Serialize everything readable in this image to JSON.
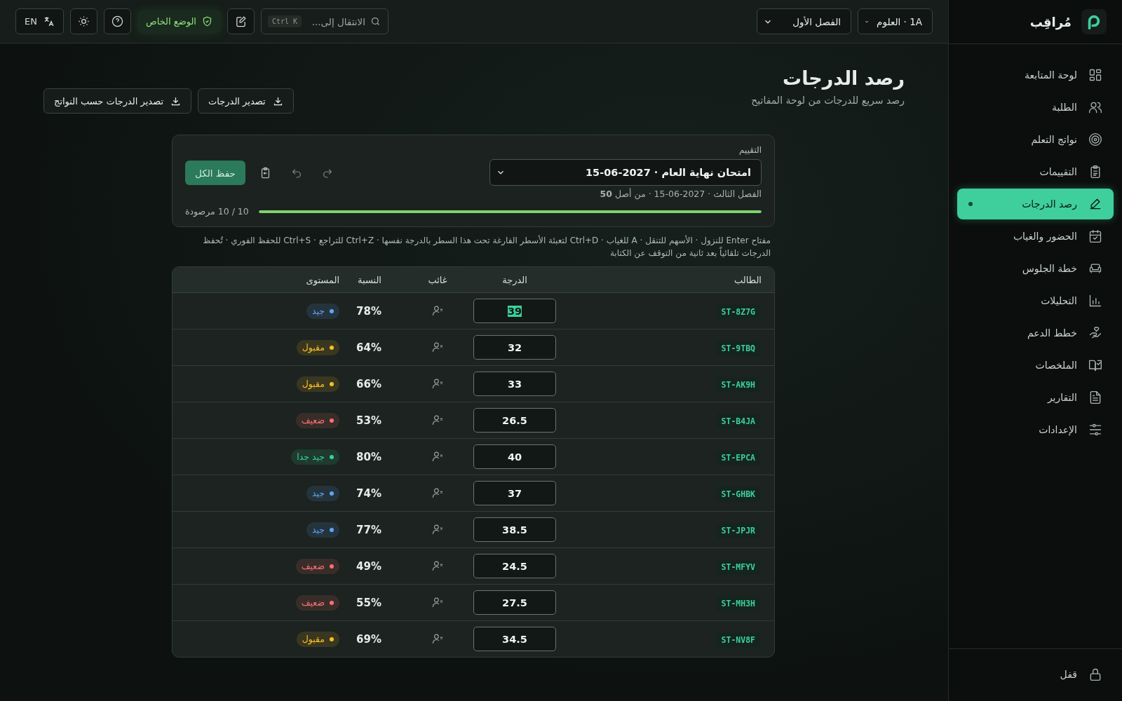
{
  "brand": {
    "name": "مُراقِب"
  },
  "sidebar": {
    "items": [
      {
        "label": "لوحة المتابعة",
        "selected": false
      },
      {
        "label": "الطلبة",
        "selected": false
      },
      {
        "label": "نواتج التعلم",
        "selected": false
      },
      {
        "label": "التقييمات",
        "selected": false
      },
      {
        "label": "رصد الدرجات",
        "selected": true
      },
      {
        "label": "الحضور والغياب",
        "selected": false
      },
      {
        "label": "خطة الجلوس",
        "selected": false
      },
      {
        "label": "التحليلات",
        "selected": false
      },
      {
        "label": "خطط الدعم",
        "selected": false
      },
      {
        "label": "الملخصات",
        "selected": false
      },
      {
        "label": "التقارير",
        "selected": false
      },
      {
        "label": "الإعدادات",
        "selected": false
      }
    ],
    "footer": {
      "label": "قفل"
    }
  },
  "topbar": {
    "class_select": "1A · العلوم",
    "term_select": "الفصل الأول",
    "search": {
      "placeholder": "الانتقال إلى...",
      "shortcut": "Ctrl K"
    },
    "private_mode": "الوضع الخاص",
    "language": "EN"
  },
  "page": {
    "title": "رصد الدرجات",
    "subtitle": "رصد سريع للدرجات من لوحة المفاتيح",
    "buttons": [
      "تصدير الدرجات",
      "تصدير الدرجات حسب النواتج"
    ]
  },
  "assessment": {
    "label": "التقييم",
    "value": "امتحان نهاية العام · 2027-06-15",
    "meta": "الفصل الثالث · 2027-06-15 · من أصل **50**",
    "save_button": "حفظ الكل",
    "progress": {
      "level": 1,
      "reading": "10 / 10 مرصودة"
    }
  },
  "hint": "مفتاح Enter للنزول · الأسهم للتنقل · A للغياب · Ctrl+D لتعبئة الأسطر الفارغة تحت هذا السطر بالدرجة نفسها · Ctrl+Z للتراجع · Ctrl+S للحفظ الفوري · تُحفظ الدرجات تلقائياً بعد ثانية من التوقف عن الكتابة",
  "table": {
    "columns": [
      "الطالب",
      "الدرجة",
      "غائب",
      "النسبة",
      "المستوى"
    ],
    "rows": [
      {
        "student": "ST-8Z7G",
        "grade": "39",
        "selected": true,
        "absent": false,
        "percent": "78%",
        "level_label": "جيد",
        "color": "#60a5fa"
      },
      {
        "student": "ST-9TBQ",
        "grade": "32",
        "selected": false,
        "absent": false,
        "percent": "64%",
        "level_label": "مقبول",
        "color": "#fbbf24"
      },
      {
        "student": "ST-AK9H",
        "grade": "33",
        "selected": false,
        "absent": false,
        "percent": "66%",
        "level_label": "مقبول",
        "color": "#fbbf24"
      },
      {
        "student": "ST-B4JA",
        "grade": "26.5",
        "selected": false,
        "absent": false,
        "percent": "53%",
        "level_label": "ضعيف",
        "color": "#f87171"
      },
      {
        "student": "ST-EPCA",
        "grade": "40",
        "selected": false,
        "absent": false,
        "percent": "80%",
        "level_label": "جيد جدا",
        "color": "#34d399"
      },
      {
        "student": "ST-GHBK",
        "grade": "37",
        "selected": false,
        "absent": false,
        "percent": "74%",
        "level_label": "جيد",
        "color": "#60a5fa"
      },
      {
        "student": "ST-JPJR",
        "grade": "38.5",
        "selected": false,
        "absent": false,
        "percent": "77%",
        "level_label": "جيد",
        "color": "#60a5fa"
      },
      {
        "student": "ST-MFYV",
        "grade": "24.5",
        "selected": false,
        "absent": false,
        "percent": "49%",
        "level_label": "ضعيف",
        "color": "#f87171"
      },
      {
        "student": "ST-MH3H",
        "grade": "27.5",
        "selected": false,
        "absent": false,
        "percent": "55%",
        "level_label": "ضعيف",
        "color": "#f87171"
      },
      {
        "student": "ST-NV8F",
        "grade": "34.5",
        "selected": false,
        "absent": false,
        "percent": "69%",
        "level_label": "مقبول",
        "color": "#fbbf24"
      }
    ]
  }
}
